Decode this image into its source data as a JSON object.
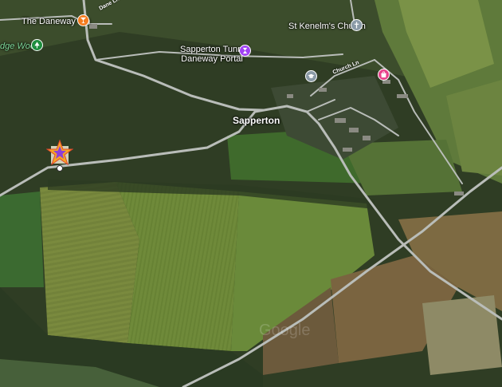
{
  "places": {
    "daneway_inn": "The Daneway Inn",
    "wood": "dge Wood",
    "st_kenelms": "St Kenelm's Church",
    "tunnel_line1": "Sapperton Tunnel",
    "tunnel_line2": "Daneway Portal",
    "sapperton": "Sapperton"
  },
  "roads": {
    "dane_ln": "Dane Ln",
    "church_ln": "Church Ln"
  },
  "watermark": "Google",
  "colors": {
    "bar_pin": "#f57c1f",
    "park_pin": "#1e8e3e",
    "church_pin": "#8a9aa6",
    "tunnel_pin": "#a142f4",
    "school_pin": "#8a9aa6",
    "shop_pin": "#e8408a",
    "marker_orange": "#f5a623",
    "marker_purple": "#8e3fd6"
  }
}
